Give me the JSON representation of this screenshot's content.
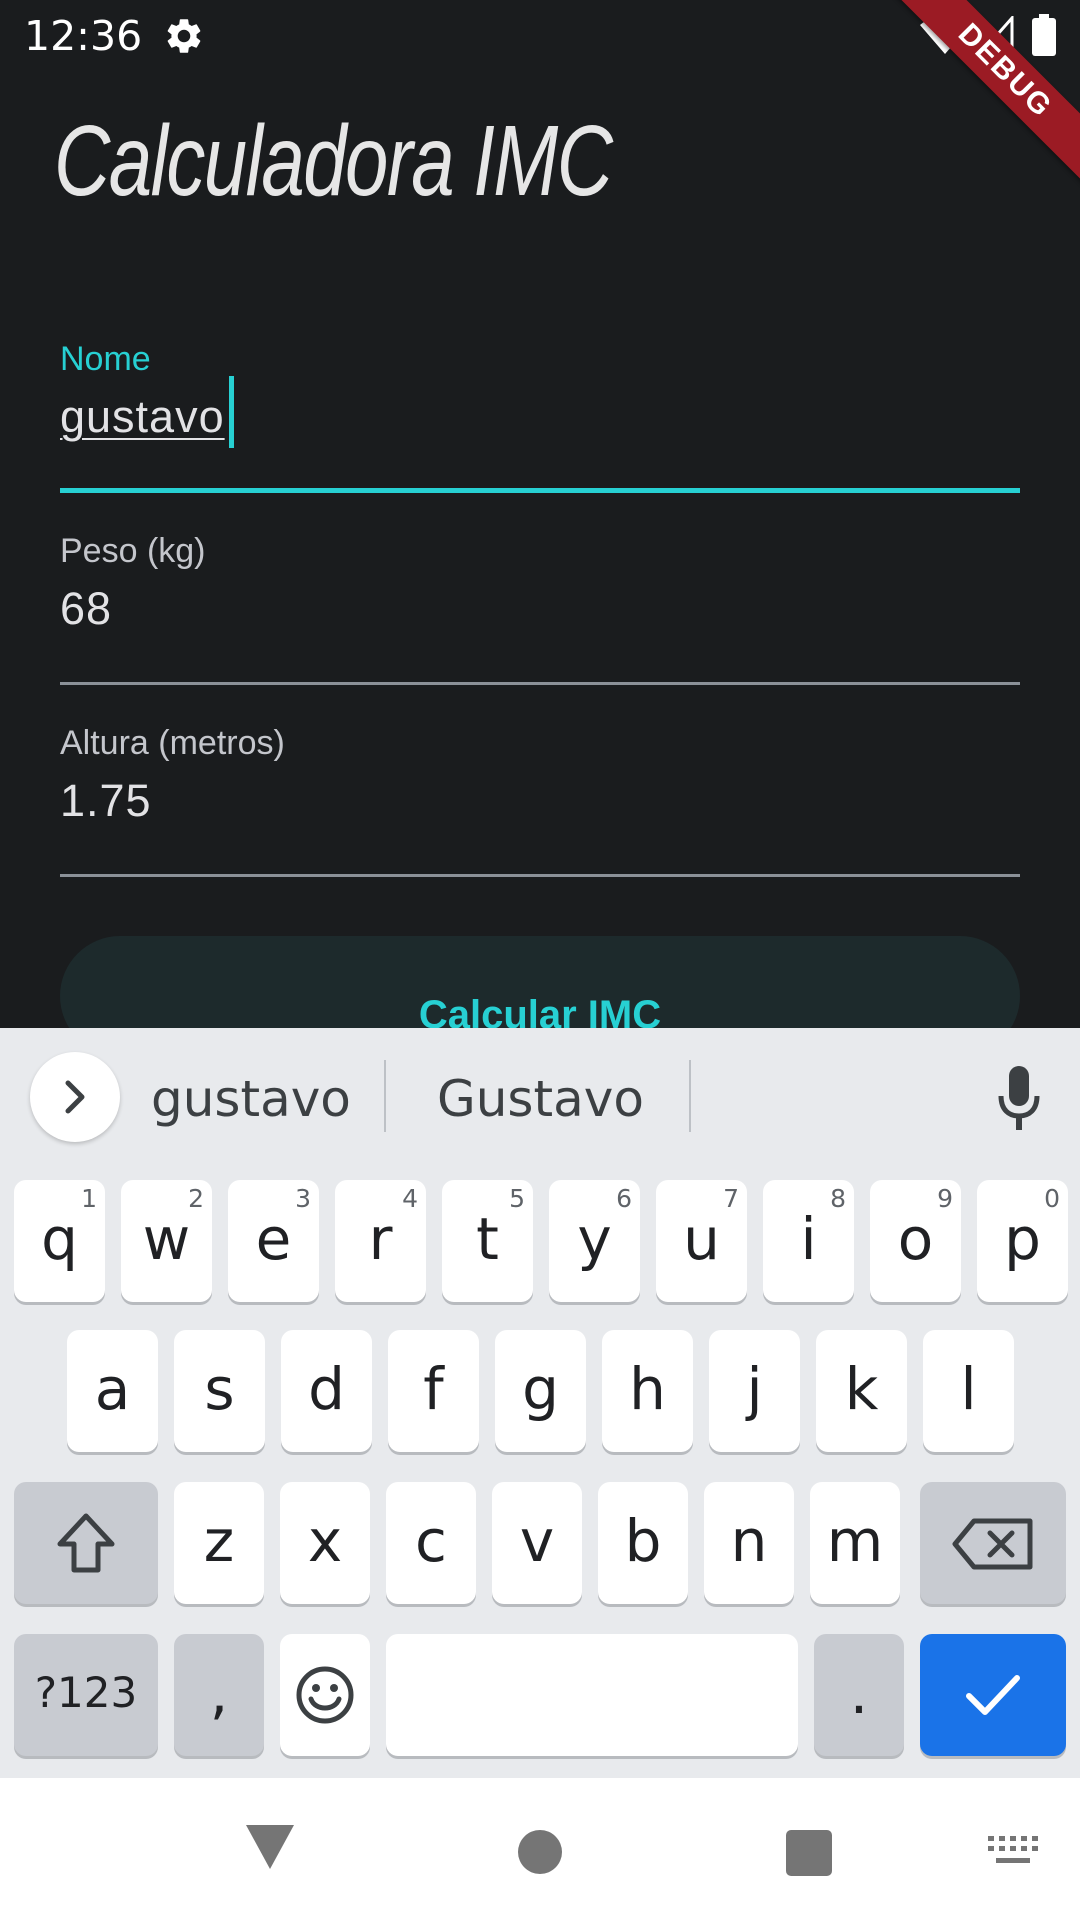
{
  "status_bar": {
    "time": "12:36",
    "icons": [
      "gear-icon",
      "wifi-icon",
      "signal-icon",
      "battery-icon"
    ],
    "debug_banner": "DEBUG"
  },
  "app": {
    "title": "Calculadora IMC",
    "accent_color": "#27d0d3",
    "fields": [
      {
        "label": "Nome",
        "value": "gustavo",
        "focused": true
      },
      {
        "label": "Peso (kg)",
        "value": "68",
        "focused": false
      },
      {
        "label": "Altura (metros)",
        "value": "1.75",
        "focused": false
      }
    ],
    "calculate_button": "Calcular IMC"
  },
  "keyboard": {
    "suggestions": [
      "gustavo",
      "Gustavo"
    ],
    "row1": [
      {
        "key": "q",
        "hint": "1"
      },
      {
        "key": "w",
        "hint": "2"
      },
      {
        "key": "e",
        "hint": "3"
      },
      {
        "key": "r",
        "hint": "4"
      },
      {
        "key": "t",
        "hint": "5"
      },
      {
        "key": "y",
        "hint": "6"
      },
      {
        "key": "u",
        "hint": "7"
      },
      {
        "key": "i",
        "hint": "8"
      },
      {
        "key": "o",
        "hint": "9"
      },
      {
        "key": "p",
        "hint": "0"
      }
    ],
    "row2": [
      "a",
      "s",
      "d",
      "f",
      "g",
      "h",
      "j",
      "k",
      "l"
    ],
    "row3": [
      "z",
      "x",
      "c",
      "v",
      "b",
      "n",
      "m"
    ],
    "symbols_key": "?123",
    "comma_key": ",",
    "period_key": ".",
    "done_color": "#1a73e8"
  }
}
